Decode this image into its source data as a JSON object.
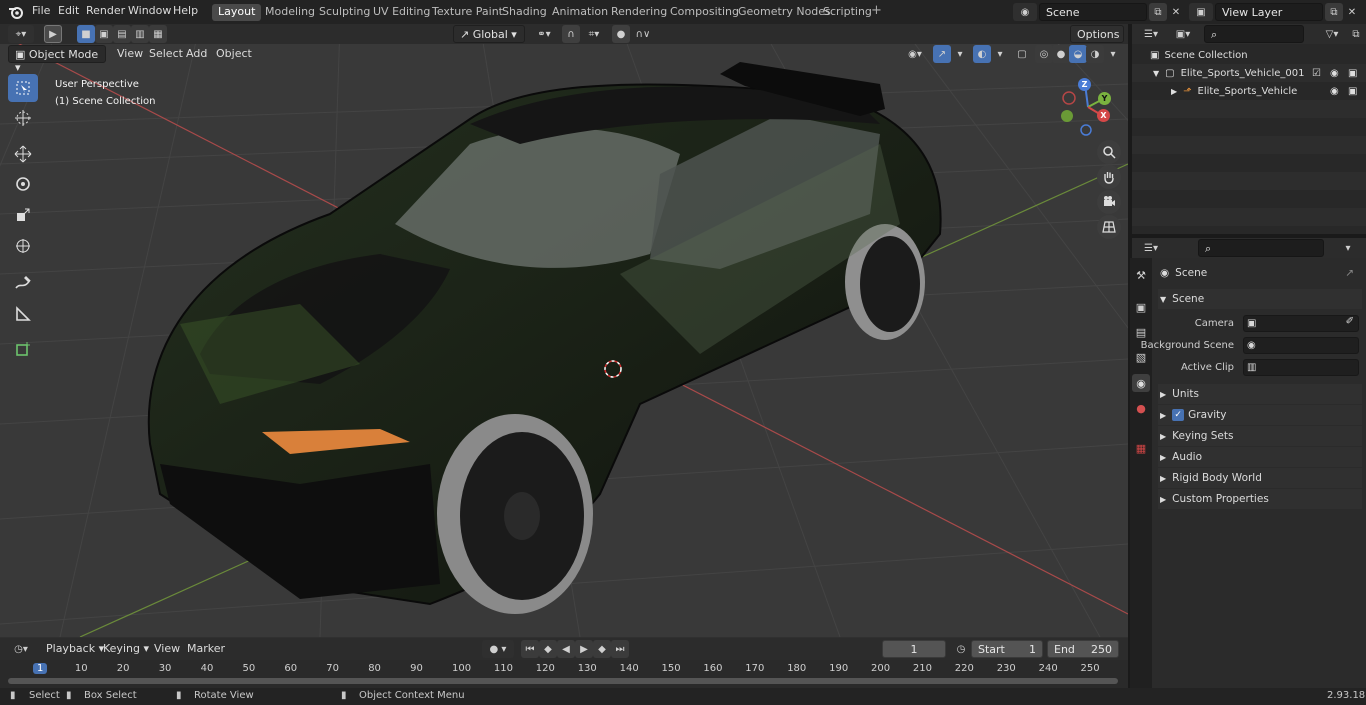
{
  "menu": [
    "File",
    "Edit",
    "Render",
    "Window",
    "Help"
  ],
  "workspaces": [
    {
      "label": "Layout",
      "active": true
    },
    {
      "label": "Modeling"
    },
    {
      "label": "Sculpting"
    },
    {
      "label": "UV Editing"
    },
    {
      "label": "Texture Paint"
    },
    {
      "label": "Shading"
    },
    {
      "label": "Animation"
    },
    {
      "label": "Rendering"
    },
    {
      "label": "Compositing"
    },
    {
      "label": "Geometry Nodes"
    },
    {
      "label": "Scripting"
    }
  ],
  "scene_field": "Scene",
  "view_layer_field": "View Layer",
  "viewport_header": {
    "mode": "Object Mode",
    "view": "View",
    "select": "Select",
    "add": "Add",
    "object": "Object",
    "transform_orientation": "Global",
    "options": "Options"
  },
  "viewport_overlay": {
    "perspective": "User Perspective",
    "collection": "(1) Scene Collection"
  },
  "gizmo": {
    "z": "Z",
    "y": "Y",
    "x": "X"
  },
  "outliner": {
    "root": "Scene Collection",
    "items": [
      {
        "label": "Elite_Sports_Vehicle_001",
        "type": "collection"
      },
      {
        "label": "Elite_Sports_Vehicle",
        "type": "object"
      }
    ]
  },
  "properties": {
    "context": "Scene",
    "panel_title": "Scene",
    "fields": [
      {
        "label": "Camera"
      },
      {
        "label": "Background Scene"
      },
      {
        "label": "Active Clip"
      }
    ],
    "subpanels": [
      "Units",
      "Gravity",
      "Keying Sets",
      "Audio",
      "Rigid Body World",
      "Custom Properties"
    ],
    "gravity_checked": true
  },
  "timeline": {
    "playback": "Playback",
    "keying": "Keying",
    "view": "View",
    "marker": "Marker",
    "current_frame": "1",
    "start_label": "Start",
    "start": "1",
    "end_label": "End",
    "end": "250",
    "ruler": [
      "1",
      "10",
      "20",
      "30",
      "40",
      "50",
      "60",
      "70",
      "80",
      "90",
      "100",
      "110",
      "120",
      "130",
      "140",
      "150",
      "160",
      "170",
      "180",
      "190",
      "200",
      "210",
      "220",
      "230",
      "240",
      "250"
    ]
  },
  "status": {
    "select": "Select",
    "box_select": "Box Select",
    "rotate_view": "Rotate View",
    "context_menu": "Object Context Menu",
    "version": "2.93.18"
  }
}
